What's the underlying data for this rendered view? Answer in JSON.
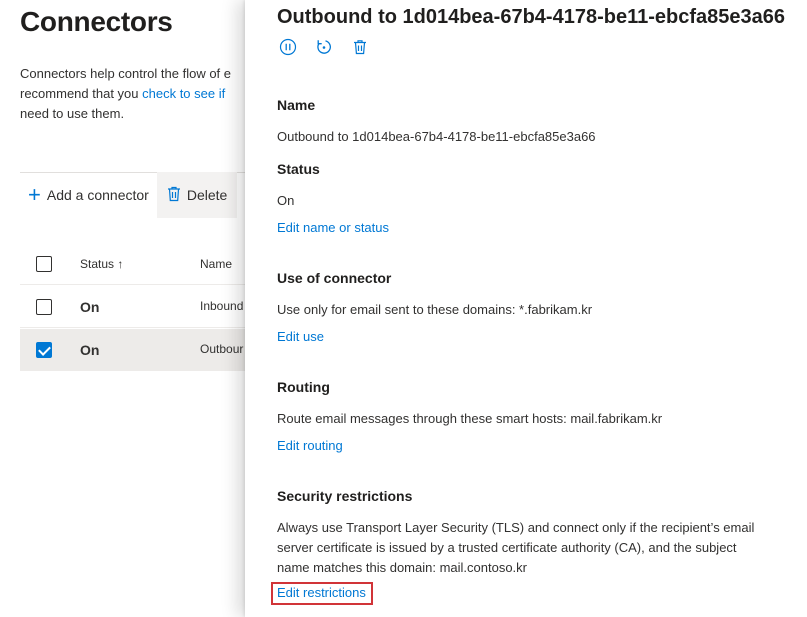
{
  "background": {
    "title": "Connectors",
    "description_line1": "Connectors help control the flow of e",
    "description_line2_prefix": "recommend that you ",
    "description_line2_link": "check to see if",
    "description_line3": "need to use them.",
    "commands": {
      "add_label": "Add a connector",
      "delete_label": "Delete"
    },
    "grid": {
      "header_status": "Status",
      "header_sort_glyph": "↑",
      "header_name": "Name",
      "rows": [
        {
          "status": "On",
          "name": "Inbound",
          "selected": false
        },
        {
          "status": "On",
          "name": "Outbour",
          "selected": true
        }
      ]
    }
  },
  "panel": {
    "title": "Outbound to 1d014bea-67b4-4178-be11-ebcfa85e3a66",
    "toolbar": {
      "icons": [
        "pause-icon",
        "refresh-icon",
        "delete-icon"
      ]
    },
    "name": {
      "heading": "Name",
      "value": "Outbound to 1d014bea-67b4-4178-be11-ebcfa85e3a66"
    },
    "status": {
      "heading": "Status",
      "value": "On",
      "edit_link": "Edit name or status"
    },
    "use": {
      "heading": "Use of connector",
      "value": "Use only for email sent to these domains: *.fabrikam.kr",
      "edit_link": "Edit use"
    },
    "routing": {
      "heading": "Routing",
      "value": "Route email messages through these smart hosts: mail.fabrikam.kr",
      "edit_link": "Edit routing"
    },
    "security": {
      "heading": "Security restrictions",
      "line1": "Always use Transport Layer Security (TLS) and connect only if the recipient’s email",
      "line2": "server certificate is issued by a trusted certificate authority (CA), and the subject",
      "line3": "name matches this domain: mail.contoso.kr",
      "edit_link": "Edit restrictions"
    }
  },
  "colors": {
    "accent": "#0078d4",
    "highlight_border": "#d13438",
    "selected_row": "#edebe9"
  }
}
